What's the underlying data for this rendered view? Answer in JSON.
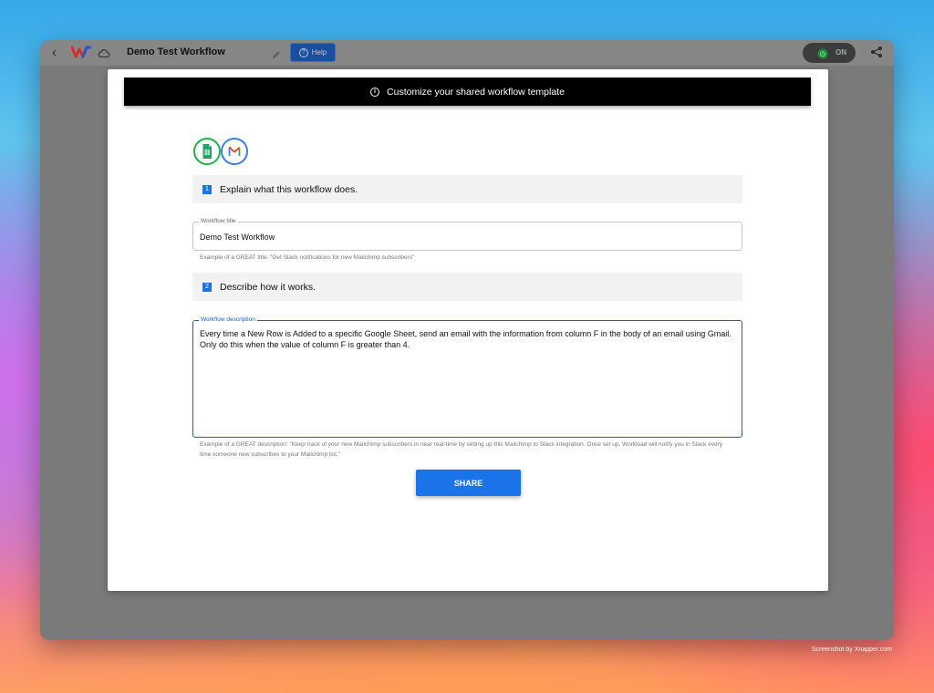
{
  "topbar": {
    "title": "Demo Test Workflow",
    "help_label": "Help",
    "toggle_label": "ON"
  },
  "banner": {
    "text": "Customize your shared workflow template"
  },
  "apps": {
    "icons": [
      "google-sheets-icon",
      "gmail-icon"
    ]
  },
  "step1": {
    "number": "1",
    "label": "Explain what this workflow does."
  },
  "title_field": {
    "legend": "Workflow title",
    "value": "Demo Test Workflow",
    "help": "Example of a GREAT title: \"Get Slack notifications for new Mailchimp subscribers\""
  },
  "step2": {
    "number": "2",
    "label": "Describe how it works."
  },
  "description_field": {
    "legend": "Workflow description",
    "value": "Every time a New Row is Added to a specific Google Sheet, send an email with the information from column F in the body of an email using Gmail. Only do this when the value of column F is greater than 4.",
    "help": "Example of a GREAT description: \"Keep track of your new Mailchimp subscribers in near real-time by setting up this Mailchimp to Slack integration. Once set up, Workload will notify you in Slack every time someone new subscribes to your Mailchimp list.\""
  },
  "share_button": {
    "label": "SHARE"
  },
  "watermark": {
    "text": "Screenshot by Xnapper.com"
  },
  "colors": {
    "accent": "#1a73e8",
    "sheets_green": "#1fb14b",
    "gmail_blue": "#3f7ee0",
    "banner_bg": "#000000"
  }
}
